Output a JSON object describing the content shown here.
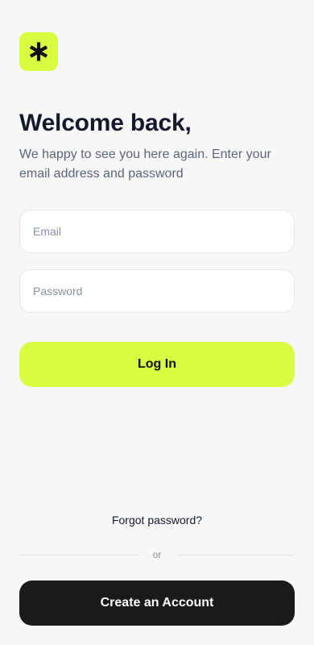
{
  "app": {
    "logo_icon": "asterisk-icon",
    "accent_color": "#d9fb41"
  },
  "header": {
    "title": "Welcome back,",
    "subtitle": "We happy to see you here again. Enter your email address and password"
  },
  "form": {
    "email": {
      "placeholder": "Email",
      "value": ""
    },
    "password": {
      "placeholder": "Password",
      "value": ""
    },
    "login_label": "Log In"
  },
  "footer": {
    "forgot_label": "Forgot password?",
    "divider_label": "or",
    "create_label": "Create an Account"
  }
}
